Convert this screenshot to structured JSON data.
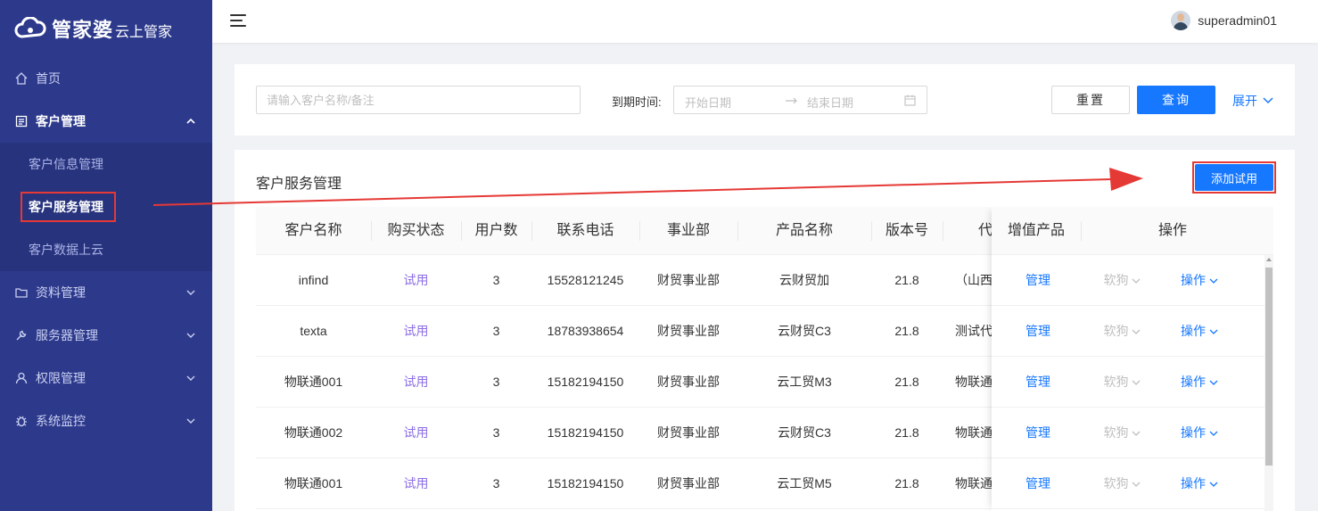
{
  "brand": {
    "name": "管家婆",
    "sub": "云上管家"
  },
  "sidebar": {
    "items": [
      {
        "label": "首页",
        "icon": "home-icon"
      },
      {
        "label": "客户管理",
        "icon": "doc-icon",
        "open": true,
        "children": [
          {
            "label": "客户信息管理"
          },
          {
            "label": "客户服务管理",
            "active": true
          },
          {
            "label": "客户数据上云"
          }
        ]
      },
      {
        "label": "资料管理",
        "icon": "folder-icon"
      },
      {
        "label": "服务器管理",
        "icon": "wrench-icon"
      },
      {
        "label": "权限管理",
        "icon": "user-icon"
      },
      {
        "label": "系统监控",
        "icon": "bug-icon"
      }
    ]
  },
  "header": {
    "username": "superadmin01"
  },
  "filter": {
    "name_placeholder": "请输入客户名称/备注",
    "date_label": "到期时间:",
    "start_placeholder": "开始日期",
    "end_placeholder": "结束日期",
    "reset_label": "重置",
    "search_label": "查询",
    "expand_label": "展开"
  },
  "card": {
    "title": "客户服务管理",
    "add_label": "添加试用"
  },
  "table": {
    "columns": [
      "客户名称",
      "购买状态",
      "用户数",
      "联系电话",
      "事业部",
      "产品名称",
      "版本号",
      "代",
      "增值产品",
      "操作"
    ],
    "rows": [
      {
        "name": "infind",
        "status": "试用",
        "users": "3",
        "phone": "15528121245",
        "dept": "财贸事业部",
        "product": "云财贸加",
        "version": "21.8",
        "agent": "（山西",
        "vas": "管理",
        "dog": "软狗",
        "op": "操作"
      },
      {
        "name": "texta",
        "status": "试用",
        "users": "3",
        "phone": "18783938654",
        "dept": "财贸事业部",
        "product": "云财贸C3",
        "version": "21.8",
        "agent": "测试代",
        "vas": "管理",
        "dog": "软狗",
        "op": "操作"
      },
      {
        "name": "物联通001",
        "status": "试用",
        "users": "3",
        "phone": "15182194150",
        "dept": "财贸事业部",
        "product": "云工贸M3",
        "version": "21.8",
        "agent": "物联通",
        "vas": "管理",
        "dog": "软狗",
        "op": "操作"
      },
      {
        "name": "物联通002",
        "status": "试用",
        "users": "3",
        "phone": "15182194150",
        "dept": "财贸事业部",
        "product": "云财贸C3",
        "version": "21.8",
        "agent": "物联通",
        "vas": "管理",
        "dog": "软狗",
        "op": "操作"
      },
      {
        "name": "物联通001",
        "status": "试用",
        "users": "3",
        "phone": "15182194150",
        "dept": "财贸事业部",
        "product": "云工贸M5",
        "version": "21.8",
        "agent": "物联通",
        "vas": "管理",
        "dog": "软狗",
        "op": "操作"
      }
    ]
  },
  "colors": {
    "sidebar": "#2d3a8c",
    "primary": "#1677ff",
    "trial": "#8c6ee6",
    "annotation": "#e53935"
  }
}
